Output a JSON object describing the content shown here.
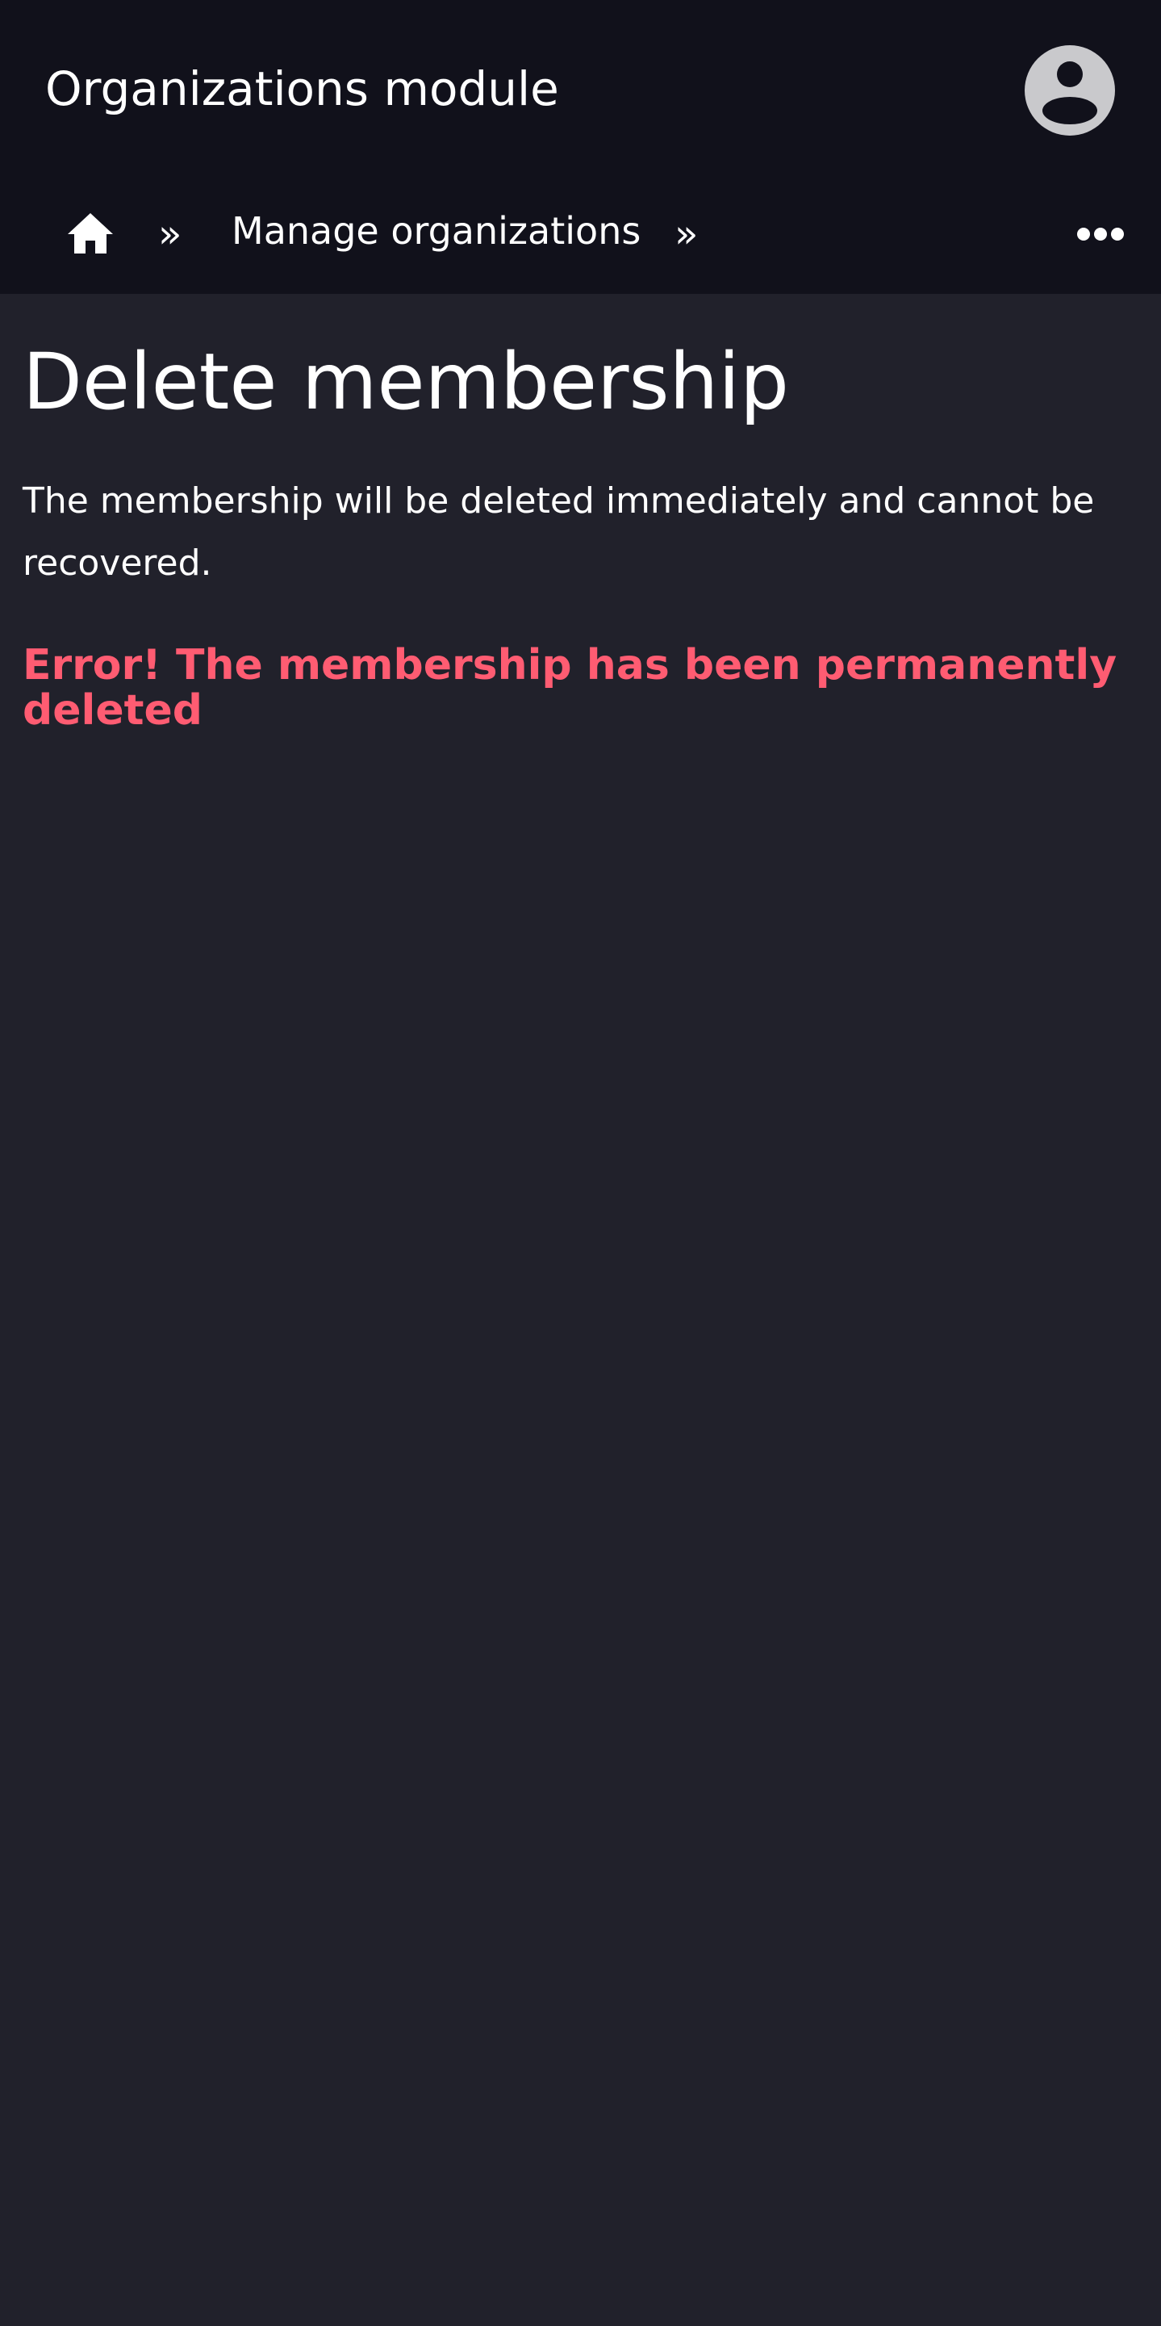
{
  "header": {
    "app_title": "Organizations module",
    "avatar_icon": "user-circle-icon"
  },
  "breadcrumb": {
    "home_icon": "home-icon",
    "separator": "»",
    "items": [
      {
        "label": "Manage organizations"
      }
    ],
    "more_icon": "ellipsis-icon"
  },
  "main": {
    "title": "Delete membership",
    "description": "The membership will be deleted immediately and cannot be recovered.",
    "error": "Error! The membership has been permanently deleted"
  },
  "colors": {
    "header_bg": "#11111b",
    "page_bg": "#21212b",
    "text": "#ffffff",
    "error": "#ff5c72",
    "avatar": "#c9c9cc"
  }
}
